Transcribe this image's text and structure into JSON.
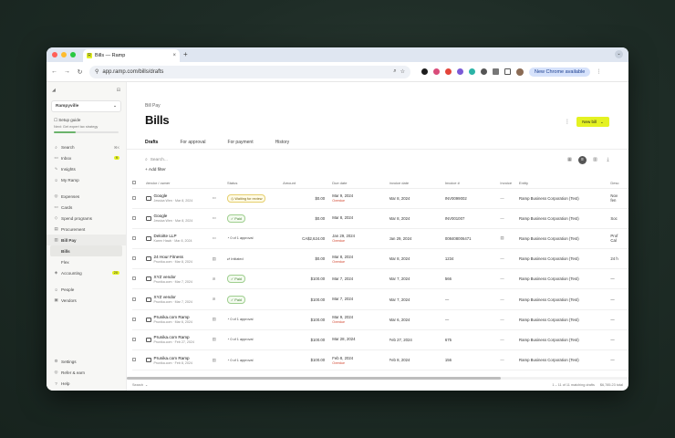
{
  "browser": {
    "tab_title": "Bills — Ramp",
    "tab_favicon": "R",
    "new_tab": "+",
    "url": "app.ramp.com/bills/drafts",
    "chrome_available": "New Chrome available",
    "menu_glyph": "⋮",
    "window_menu": "⌄",
    "back": "←",
    "forward": "→",
    "reload": "↻"
  },
  "sidebar": {
    "collapse_glyph": "⊟",
    "logo_glyph": "◢",
    "business": "Rampyville",
    "business_chevron": "⌄",
    "setup_guide": "Setup guide",
    "next_step": "Next: Get expert tax strategy",
    "setup_progress": 0.34,
    "items": [
      {
        "label": "Search",
        "icon": "⌕",
        "badge": "⌘K"
      },
      {
        "label": "Inbox",
        "icon": "▭",
        "badge": "9"
      },
      {
        "label": "Insights",
        "icon": "∿"
      },
      {
        "label": "My Ramp",
        "icon": "☺"
      }
    ],
    "items2": [
      {
        "label": "Expenses",
        "icon": "◎"
      },
      {
        "label": "Cards",
        "icon": "▭"
      },
      {
        "label": "Spend programs",
        "icon": "◇"
      },
      {
        "label": "Procurement",
        "icon": "▤"
      },
      {
        "label": "Bill Pay",
        "icon": "▥"
      }
    ],
    "billpay_sub": [
      "Bills",
      "Flex"
    ],
    "items3": [
      {
        "label": "Accounting",
        "icon": "◈",
        "badge": "20"
      }
    ],
    "items4": [
      {
        "label": "People",
        "icon": "☺"
      },
      {
        "label": "Vendors",
        "icon": "▣"
      }
    ],
    "bottom": [
      {
        "label": "Settings",
        "icon": "⚙"
      },
      {
        "label": "Refer & earn",
        "icon": "◎"
      },
      {
        "label": "Help",
        "icon": "?"
      }
    ]
  },
  "page": {
    "breadcrumb": "Bill Pay",
    "title": "Bills",
    "more": "⋮",
    "new_bill": "New bill",
    "new_bill_chevron": "⌄",
    "tabs": [
      "Drafts",
      "For approval",
      "For payment",
      "History"
    ],
    "search_placeholder": "Search...",
    "add_filter": "+ Add filter"
  },
  "table": {
    "headers": [
      "",
      "Vendor / owner",
      "",
      "Status",
      "Amount",
      "Due date",
      "Invoice date",
      "Invoice #",
      "Invoice",
      "Entity",
      "Desc"
    ],
    "rows": [
      {
        "vendor": "Google",
        "sub": "Jessica Wen · Mar 8, 2024",
        "status": "Waiting for review",
        "status_kind": "yellow",
        "amount": "$0.00",
        "due": "Mar 9, 2024",
        "overdue": "Overdue",
        "invoice_date": "Mar 8, 2024",
        "invoice_no": "INV0099002",
        "invoice_file": "—",
        "entity": "Ramp Business Corporation (Test)",
        "desc": "Nov\nfen"
      },
      {
        "vendor": "Google",
        "sub": "Jessica Wen · Mar 8, 2024",
        "status": "Paid",
        "status_kind": "green",
        "amount": "$0.00",
        "due": "Mar 8, 2024",
        "overdue": "",
        "invoice_date": "Mar 8, 2024",
        "invoice_no": "INV001007",
        "invoice_file": "—",
        "entity": "Ramp Business Corporation (Test)",
        "desc": "Soc"
      },
      {
        "vendor": "Deloitte LLP",
        "sub": "Karen Hawk · Mar 8, 2024",
        "status": "0 of 1 approval",
        "status_kind": "plain",
        "amount": "CA$2,624.00",
        "due": "Jan 29, 2024",
        "overdue": "Overdue",
        "invoice_date": "Jan 29, 2024",
        "invoice_no": "008408006471",
        "invoice_file": "▤",
        "entity": "Ramp Business Corporation (Test)",
        "desc": "Prof\nCal"
      },
      {
        "vendor": "24 Hour Fitness",
        "sub": "Prunika.com · Mar 8, 2024",
        "status": "Initiated",
        "status_kind": "plain",
        "amount": "$0.00",
        "due": "Mar 8, 2024",
        "overdue": "Overdue",
        "invoice_date": "Mar 8, 2024",
        "invoice_no": "1234",
        "invoice_file": "—",
        "entity": "Ramp Business Corporation (Test)",
        "desc": "24 h"
      },
      {
        "vendor": "XYZ vendor",
        "sub": "Prunika.com · Mar 7, 2024",
        "status": "Paid",
        "status_kind": "green",
        "amount": "$100.00",
        "due": "Mar 7, 2024",
        "overdue": "",
        "invoice_date": "Mar 7, 2024",
        "invoice_no": "566",
        "invoice_file": "—",
        "entity": "Ramp Business Corporation (Test)",
        "desc": "—"
      },
      {
        "vendor": "XYZ vendor",
        "sub": "Prunika.com · Mar 7, 2024",
        "status": "Paid",
        "status_kind": "green",
        "amount": "$100.00",
        "due": "Mar 7, 2024",
        "overdue": "",
        "invoice_date": "Mar 7, 2024",
        "invoice_no": "—",
        "invoice_file": "—",
        "entity": "Ramp Business Corporation (Test)",
        "desc": "—"
      },
      {
        "vendor": "Prunika.com Ramp",
        "sub": "Prunika.com · Mar 6, 2024",
        "status": "0 of 1 approval",
        "status_kind": "plain",
        "amount": "$100.00",
        "due": "Mar 9, 2024",
        "overdue": "Overdue",
        "invoice_date": "Mar 6, 2024",
        "invoice_no": "—",
        "invoice_file": "—",
        "entity": "Ramp Business Corporation (Test)",
        "desc": "—"
      },
      {
        "vendor": "Prunika.com Ramp",
        "sub": "Prunika.com · Feb 27, 2024",
        "status": "0 of 1 approval",
        "status_kind": "plain",
        "amount": "$100.00",
        "due": "Mar 28, 2024",
        "overdue": "",
        "invoice_date": "Feb 27, 2024",
        "invoice_no": "675",
        "invoice_file": "—",
        "entity": "Ramp Business Corporation (Test)",
        "desc": "—"
      },
      {
        "vendor": "Prunika.com Ramp",
        "sub": "Prunika.com · Feb 8, 2024",
        "status": "0 of 1 approval",
        "status_kind": "plain",
        "amount": "$100.00",
        "due": "Feb 8, 2024",
        "overdue": "Overdue",
        "invoice_date": "Feb 8, 2024",
        "invoice_no": "156",
        "invoice_file": "—",
        "entity": "Ramp Business Corporation (Test)",
        "desc": "—"
      }
    ]
  },
  "footer": {
    "search": "Search",
    "search_chevron": "⌄",
    "count": "1 – 11 of 11 matching drafts",
    "total": "$6,785.23 total"
  },
  "colors": {
    "accent": "#e4f222",
    "overdue": "#d2452e",
    "paid": "#3d7a2c"
  }
}
